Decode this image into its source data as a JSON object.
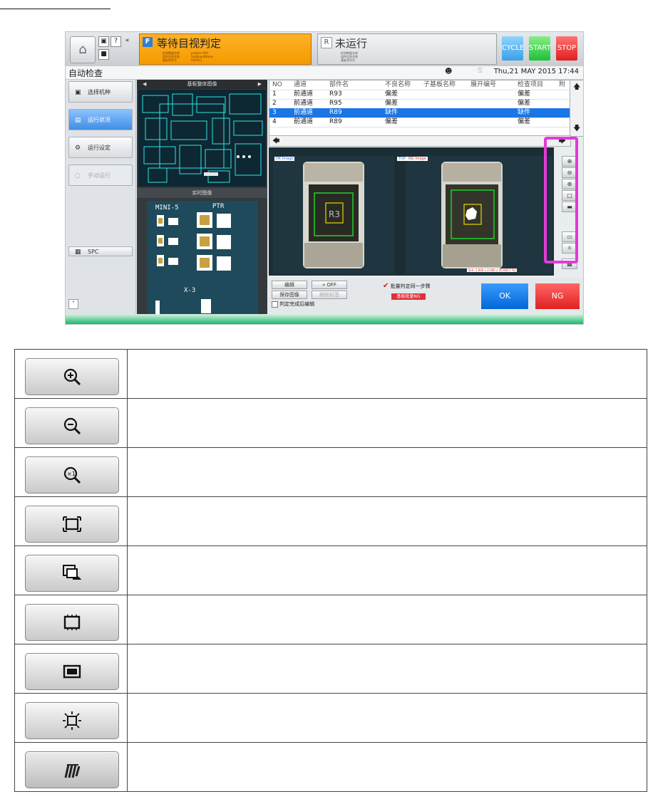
{
  "header": {
    "status_left_tag": "F",
    "status_left": "等待目视判定",
    "status_left_lines": [
      "检测数据名称",
      "组件信息名称",
      "基板序列号"
    ],
    "status_left_values": [
      "product-001",
      "SubBoardName",
      "000421"
    ],
    "status_right_tag": "R",
    "status_right": "未运行",
    "status_right_lines": [
      "检测数据名称",
      "组件信息名称",
      "基板序列号"
    ],
    "cycle": "CYCLE",
    "start": "START",
    "stop": "STOP"
  },
  "titlebar": {
    "page_title": "自动检查",
    "datetime": "Thu,21 MAY 2015  17:44"
  },
  "sidebar": {
    "items": [
      {
        "label": "选择机种"
      },
      {
        "label": "运行状况"
      },
      {
        "label": "运行设定"
      },
      {
        "label": "手动运行"
      },
      {
        "label": "SPC"
      }
    ]
  },
  "pcb": {
    "title": "基板整体图像",
    "live_title": "实时图像",
    "labels": [
      "MINI-5",
      "PTR",
      "X-3"
    ]
  },
  "table": {
    "columns": [
      "NO",
      "通道",
      "部件名",
      "不良名称",
      "子基板名称",
      "展开编号",
      "检查项目",
      "附"
    ],
    "rows": [
      [
        "1",
        "前通道",
        "R93",
        "偏差",
        "",
        "",
        "偏差",
        ""
      ],
      [
        "2",
        "前通道",
        "R95",
        "偏差",
        "",
        "",
        "偏差",
        ""
      ],
      [
        "3",
        "前通道",
        "R89",
        "缺件",
        "",
        "",
        "缺件",
        ""
      ],
      [
        "4",
        "前通道",
        "R89",
        "偏差",
        "",
        "",
        "偏差",
        ""
      ]
    ]
  },
  "views": {
    "ok_label": "OK Image",
    "ng_label": "NG Image",
    "top_label": "TOP",
    "coords": "Sch: 1.000 x 2.000 x 30.000 [ %]"
  },
  "bottom": {
    "edit": "编辑",
    "mute": "OFF",
    "save_image": "保存图像",
    "delete_label": "删除标签",
    "auto_edit": "判定完成后编辑",
    "batch_same": "批量判定同一步骤",
    "board_ng": "基板批量NG",
    "ok": "OK",
    "ng": "NG"
  },
  "legend": {
    "icons": [
      "zoom-in-icon",
      "zoom-out-icon",
      "zoom-1x-icon",
      "fit-to-window-icon",
      "image-overlay-icon",
      "component-outline-icon",
      "window-frame-icon",
      "lighting-icon",
      "hatching-icon"
    ]
  }
}
